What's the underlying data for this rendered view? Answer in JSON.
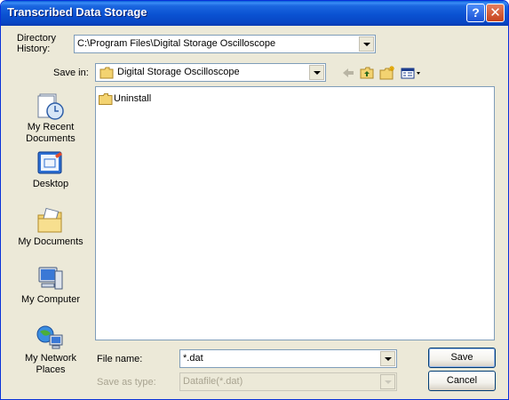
{
  "window": {
    "title": "Transcribed Data Storage",
    "help_icon": "help-icon",
    "close_icon": "close-icon",
    "help_glyph": "?",
    "close_glyph": "✕"
  },
  "directory_history": {
    "label": "Directory\nHistory:",
    "value": "C:\\Program Files\\Digital Storage Oscilloscope"
  },
  "save_in": {
    "label": "Save in:",
    "value": "Digital Storage Oscilloscope",
    "toolbar_icons": [
      "back-arrow-icon",
      "up-folder-icon",
      "new-folder-icon",
      "views-menu-icon"
    ]
  },
  "places": [
    {
      "label": "My Recent\nDocuments",
      "icon": "recent-documents-icon"
    },
    {
      "label": "Desktop",
      "icon": "desktop-icon"
    },
    {
      "label": "My Documents",
      "icon": "my-documents-icon"
    },
    {
      "label": "My Computer",
      "icon": "my-computer-icon"
    },
    {
      "label": "My Network\nPlaces",
      "icon": "network-places-icon"
    }
  ],
  "files": [
    {
      "name": "Uninstall",
      "icon": "folder-icon"
    }
  ],
  "file_name": {
    "label": "File name:",
    "value": "*.dat"
  },
  "save_as_type": {
    "label": "Save as type:",
    "value": "Datafile(*.dat)"
  },
  "buttons": {
    "save": "Save",
    "cancel": "Cancel"
  },
  "colors": {
    "titlebar": "#0a52d2",
    "window_bg": "#ece9d8",
    "border_blue": "#7f9db9"
  }
}
